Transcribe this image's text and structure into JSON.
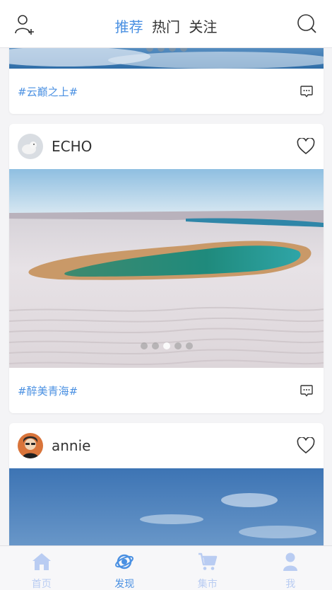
{
  "header": {
    "tabs": [
      {
        "label": "推荐",
        "active": true
      },
      {
        "label": "热门",
        "active": false
      },
      {
        "label": "关注",
        "active": false
      }
    ],
    "left_icon": "add-user-icon",
    "right_icon": "search-icon"
  },
  "posts": [
    {
      "username": "",
      "tag": "#云巅之上#",
      "image": "sea of clouds"
    },
    {
      "username": "ECHO",
      "tag": "#醉美青海#",
      "image": "white dunes with turquoise lagoon",
      "carousel_total": 5,
      "carousel_active": 3
    },
    {
      "username": "annie",
      "tag": "",
      "image": "blue sky with clouds"
    }
  ],
  "bottom_nav": [
    {
      "label": "首页",
      "icon": "home-icon",
      "active": false
    },
    {
      "label": "发现",
      "icon": "discover-planet-icon",
      "active": true
    },
    {
      "label": "集市",
      "icon": "cart-icon",
      "active": false
    },
    {
      "label": "我",
      "icon": "person-icon",
      "active": false
    }
  ],
  "colors": {
    "accent": "#4a90e2",
    "inactive_nav": "#b9ccf2",
    "background": "#f4f4f6"
  }
}
